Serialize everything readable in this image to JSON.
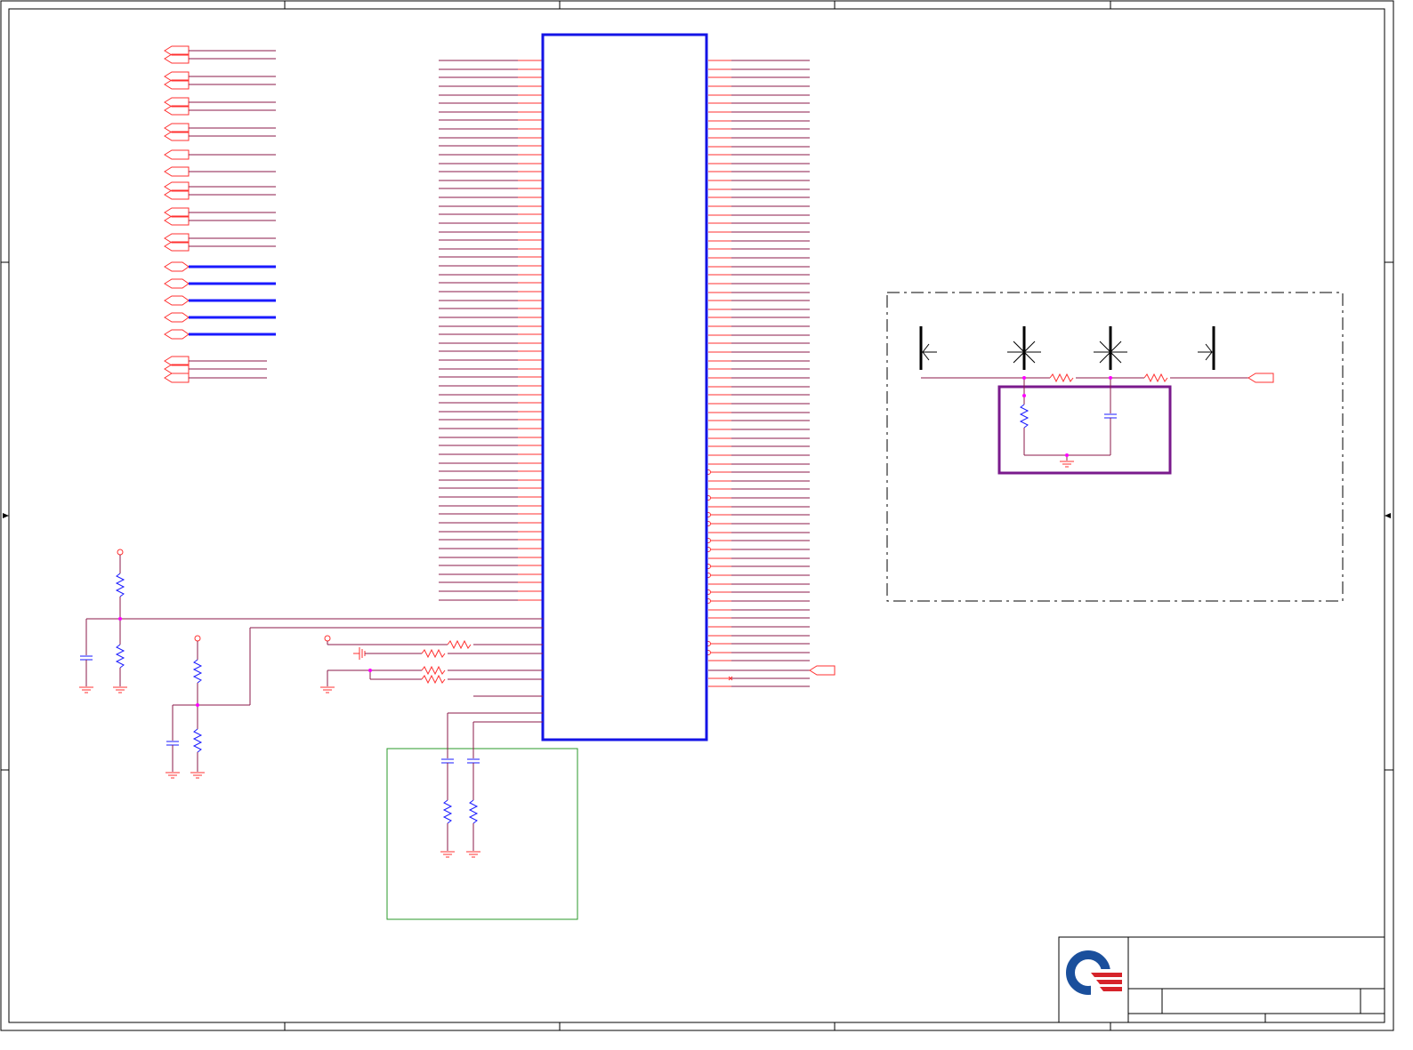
{
  "colors": {
    "frame": "#000000",
    "wire": "#8b1a4a",
    "pin": "#ff3030",
    "bus": "#1a1aff",
    "chip": "#1414e6",
    "component_blue": "#1a1aff",
    "junction": "#ff00ff",
    "emi_box": "#7a1a8c",
    "rc_box": "#2a9a2a",
    "logo_blue": "#1a4f9c",
    "logo_red": "#d6232a"
  },
  "sheet": {
    "left_edge_marker": "arrow-right-icon",
    "right_edge_marker": "arrow-left-icon"
  },
  "title_block": {
    "logo": "company-logo-icon"
  },
  "schematic": {
    "main_chip": "ic-package",
    "emi_region": "dash-dot-boundary",
    "rc_region": "rc-filter-group",
    "output_port": "off-page-connector-icon"
  }
}
